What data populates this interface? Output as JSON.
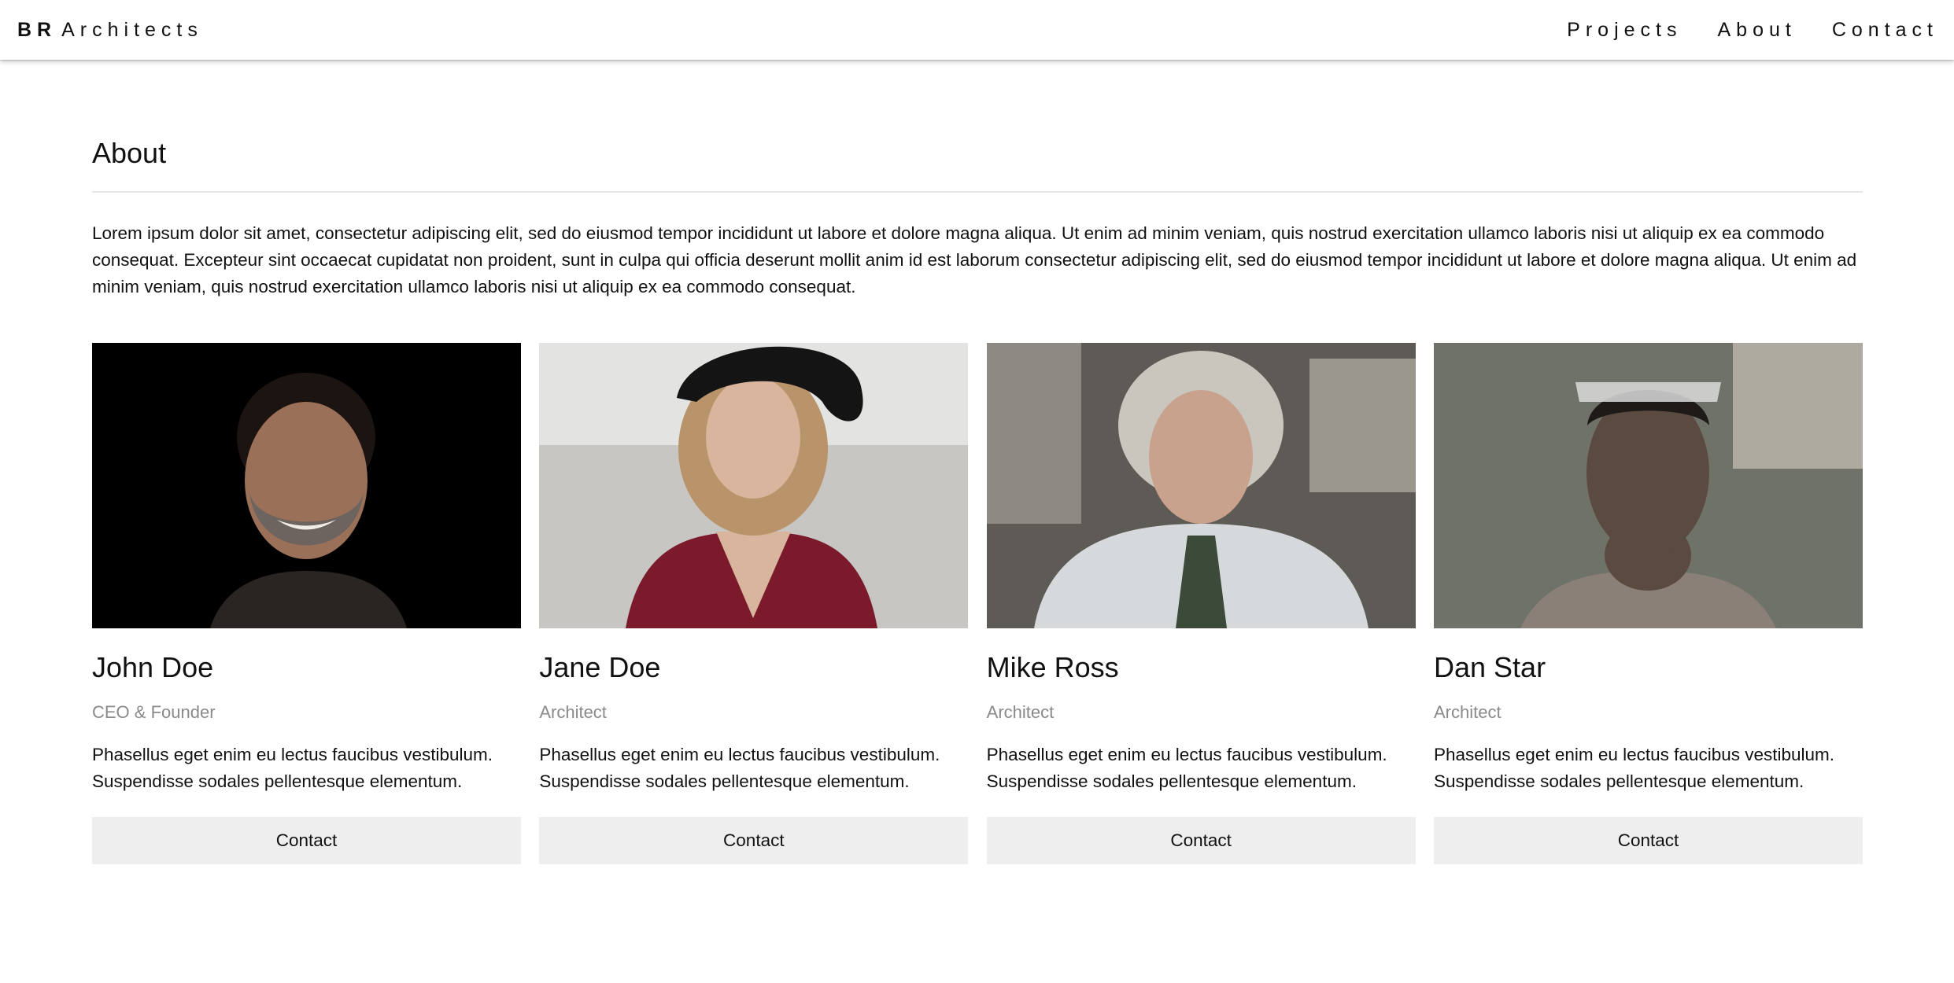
{
  "nav": {
    "brand_bold": "BR",
    "brand_rest": "Architects",
    "links": [
      "Projects",
      "About",
      "Contact"
    ]
  },
  "about": {
    "title": "About",
    "intro": "Lorem ipsum dolor sit amet, consectetur adipiscing elit, sed do eiusmod tempor incididunt ut labore et dolore magna aliqua. Ut enim ad minim veniam, quis nostrud exercitation ullamco laboris nisi ut aliquip ex ea commodo consequat. Excepteur sint occaecat cupidatat non proident, sunt in culpa qui officia deserunt mollit anim id est laborum consectetur adipiscing elit, sed do eiusmod tempor incididunt ut labore et dolore magna aliqua. Ut enim ad minim veniam, quis nostrud exercitation ullamco laboris nisi ut aliquip ex ea commodo consequat."
  },
  "team": [
    {
      "name": "John Doe",
      "role": "CEO & Founder",
      "bio_line1": "Phasellus eget enim eu lectus faucibus vestibulum.",
      "bio_line2": "Suspendisse sodales pellentesque elementum.",
      "button": "Contact",
      "photo_bg": "#000000",
      "skin": "#9a7058",
      "hair": "#1c1410",
      "clothes": "#2a2522"
    },
    {
      "name": "Jane Doe",
      "role": "Architect",
      "bio_line1": "Phasellus eget enim eu lectus faucibus vestibulum.",
      "bio_line2": "Suspendisse sodales pellentesque elementum.",
      "button": "Contact",
      "photo_bg": "#d9d9d9",
      "skin": "#d8b59c",
      "hair": "#b9946a",
      "clothes": "#7a1a2a"
    },
    {
      "name": "Mike Ross",
      "role": "Architect",
      "bio_line1": "Phasellus eget enim eu lectus faucibus vestibulum.",
      "bio_line2": "Suspendisse sodales pellentesque elementum.",
      "button": "Contact",
      "photo_bg": "#5e5a55",
      "skin": "#c9a28e",
      "hair": "#c9c6bd",
      "clothes": "#d6d9dc"
    },
    {
      "name": "Dan Star",
      "role": "Architect",
      "bio_line1": "Phasellus eget enim eu lectus faucibus vestibulum.",
      "bio_line2": "Suspendisse sodales pellentesque elementum.",
      "button": "Contact",
      "photo_bg": "#6f7268",
      "skin": "#5a4a40",
      "hair": "#1e1a18",
      "clothes": "#8a8078"
    }
  ]
}
